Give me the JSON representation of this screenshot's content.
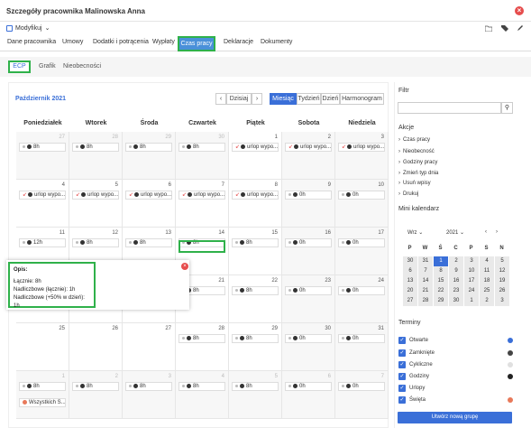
{
  "window": {
    "title": "Szczegóły pracownika Malinowska Anna"
  },
  "action": {
    "modify": "Modyfikuj"
  },
  "tabs": [
    "Dane pracownika",
    "Umowy",
    "Dodatki i potrącenia",
    "Wypłaty",
    "Czas pracy",
    "Deklaracje",
    "Dokumenty"
  ],
  "subtabs": [
    "ECP",
    "Grafik",
    "Nieobecności"
  ],
  "calendar": {
    "month": "Październik 2021",
    "today": "Dzisiaj",
    "views": [
      "Miesiąc",
      "Tydzień",
      "Dzień",
      "Harmonogram"
    ],
    "days": [
      "Poniedziałek",
      "Wtorek",
      "Środa",
      "Czwartek",
      "Piątek",
      "Sobota",
      "Niedziela"
    ],
    "weeks": [
      [
        {
          "n": "27",
          "o": true,
          "e": "8h"
        },
        {
          "n": "28",
          "o": true,
          "e": "8h"
        },
        {
          "n": "29",
          "o": true,
          "e": "8h"
        },
        {
          "n": "30",
          "o": true,
          "e": "8h"
        },
        {
          "n": "1",
          "e": "urlop wypo...",
          "u": true
        },
        {
          "n": "2",
          "e": "urlop wypo...",
          "u": true
        },
        {
          "n": "3",
          "e": "urlop wypo...",
          "u": true
        }
      ],
      [
        {
          "n": "4",
          "e": "urlop wypo...",
          "u": true
        },
        {
          "n": "5",
          "e": "urlop wypo...",
          "u": true
        },
        {
          "n": "6",
          "e": "urlop wypo...",
          "u": true
        },
        {
          "n": "7",
          "e": "urlop wypo...",
          "u": true
        },
        {
          "n": "8",
          "e": "urlop wypo...",
          "u": true
        },
        {
          "n": "9",
          "e": "0h"
        },
        {
          "n": "10",
          "e": "0h"
        }
      ],
      [
        {
          "n": "11",
          "e": "12h"
        },
        {
          "n": "12",
          "e": "8h"
        },
        {
          "n": "13",
          "e": "8h"
        },
        {
          "n": "14",
          "e": "8h"
        },
        {
          "n": "15",
          "e": "8h"
        },
        {
          "n": "16",
          "e": "0h"
        },
        {
          "n": "17",
          "e": "0h"
        }
      ],
      [
        {
          "n": "18",
          "e": ""
        },
        {
          "n": "19",
          "e": ""
        },
        {
          "n": "20",
          "e": ""
        },
        {
          "n": "21",
          "e": "8h"
        },
        {
          "n": "22",
          "e": "8h"
        },
        {
          "n": "23",
          "e": "0h"
        },
        {
          "n": "24",
          "e": "0h"
        }
      ],
      [
        {
          "n": "25",
          "e": ""
        },
        {
          "n": "26",
          "e": ""
        },
        {
          "n": "27",
          "e": ""
        },
        {
          "n": "28",
          "e": "8h"
        },
        {
          "n": "29",
          "e": "8h"
        },
        {
          "n": "30",
          "e": "0h"
        },
        {
          "n": "31",
          "e": "0h"
        }
      ],
      [
        {
          "n": "1",
          "o": true,
          "e": "8h",
          "h": "Wszystkich Ś..."
        },
        {
          "n": "2",
          "o": true,
          "e": "8h"
        },
        {
          "n": "3",
          "o": true,
          "e": "8h"
        },
        {
          "n": "4",
          "o": true,
          "e": "8h"
        },
        {
          "n": "5",
          "o": true,
          "e": "8h"
        },
        {
          "n": "6",
          "o": true,
          "e": "0h"
        },
        {
          "n": "7",
          "o": true,
          "e": "0h"
        }
      ]
    ]
  },
  "popup": {
    "title": "Opis:",
    "line1": "Łącznie: 8h",
    "line2": "Nadliczbowe (łącznie): 1h",
    "line3": "Nadliczbowe (+50% w dzień): 1h"
  },
  "sidebar": {
    "filter": "Filtr",
    "actions_title": "Akcje",
    "actions": [
      "Czas pracy",
      "Nieobecność",
      "Godziny pracy",
      "Zmień typ dnia",
      "Usuń wpisy",
      "Drukuj"
    ],
    "mini_title": "Mini kalendarz",
    "mini_month": "Wrz",
    "mini_year": "2021",
    "mini_days": [
      "P",
      "W",
      "Ś",
      "C",
      "P",
      "S",
      "N"
    ],
    "mini_weeks": [
      [
        "30",
        "31",
        "1",
        "2",
        "3",
        "4",
        "5"
      ],
      [
        "6",
        "7",
        "8",
        "9",
        "10",
        "11",
        "12"
      ],
      [
        "13",
        "14",
        "15",
        "16",
        "17",
        "18",
        "19"
      ],
      [
        "20",
        "21",
        "22",
        "23",
        "24",
        "25",
        "26"
      ],
      [
        "27",
        "28",
        "29",
        "30",
        "1",
        "2",
        "3"
      ]
    ],
    "terms_title": "Terminy",
    "terms": [
      {
        "label": "Otwarte",
        "color": "#3a6fd8"
      },
      {
        "label": "Zamknięte",
        "color": "#444444"
      },
      {
        "label": "Cykliczne",
        "color": "#e0e0e0"
      },
      {
        "label": "Godziny",
        "color": "#222222"
      },
      {
        "label": "Urlopy",
        "color": ""
      },
      {
        "label": "Święta",
        "color": "#e8795a"
      }
    ],
    "new_group": "Utwórz nową grupę"
  }
}
